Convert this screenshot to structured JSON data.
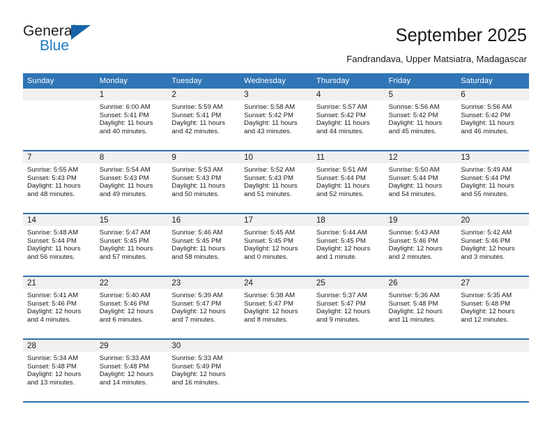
{
  "brand": {
    "name_top": "General",
    "name_bottom": "Blue",
    "accent_color": "#1463a8",
    "blue_text_color": "#1f7ac0"
  },
  "header": {
    "title": "September 2025",
    "subtitle": "Fandrandava, Upper Matsiatra, Madagascar"
  },
  "calendar": {
    "header_bg": "#3075b5",
    "row_border_color": "#2f6fad",
    "daynum_bg": "#f0f0f0",
    "weekday_headers": [
      "Sunday",
      "Monday",
      "Tuesday",
      "Wednesday",
      "Thursday",
      "Friday",
      "Saturday"
    ],
    "weeks": [
      [
        {
          "day": "",
          "lines": []
        },
        {
          "day": "1",
          "lines": [
            "Sunrise: 6:00 AM",
            "Sunset: 5:41 PM",
            "Daylight: 11 hours",
            "and 40 minutes."
          ]
        },
        {
          "day": "2",
          "lines": [
            "Sunrise: 5:59 AM",
            "Sunset: 5:41 PM",
            "Daylight: 11 hours",
            "and 42 minutes."
          ]
        },
        {
          "day": "3",
          "lines": [
            "Sunrise: 5:58 AM",
            "Sunset: 5:42 PM",
            "Daylight: 11 hours",
            "and 43 minutes."
          ]
        },
        {
          "day": "4",
          "lines": [
            "Sunrise: 5:57 AM",
            "Sunset: 5:42 PM",
            "Daylight: 11 hours",
            "and 44 minutes."
          ]
        },
        {
          "day": "5",
          "lines": [
            "Sunrise: 5:56 AM",
            "Sunset: 5:42 PM",
            "Daylight: 11 hours",
            "and 45 minutes."
          ]
        },
        {
          "day": "6",
          "lines": [
            "Sunrise: 5:56 AM",
            "Sunset: 5:42 PM",
            "Daylight: 11 hours",
            "and 46 minutes."
          ]
        }
      ],
      [
        {
          "day": "7",
          "lines": [
            "Sunrise: 5:55 AM",
            "Sunset: 5:43 PM",
            "Daylight: 11 hours",
            "and 48 minutes."
          ]
        },
        {
          "day": "8",
          "lines": [
            "Sunrise: 5:54 AM",
            "Sunset: 5:43 PM",
            "Daylight: 11 hours",
            "and 49 minutes."
          ]
        },
        {
          "day": "9",
          "lines": [
            "Sunrise: 5:53 AM",
            "Sunset: 5:43 PM",
            "Daylight: 11 hours",
            "and 50 minutes."
          ]
        },
        {
          "day": "10",
          "lines": [
            "Sunrise: 5:52 AM",
            "Sunset: 5:43 PM",
            "Daylight: 11 hours",
            "and 51 minutes."
          ]
        },
        {
          "day": "11",
          "lines": [
            "Sunrise: 5:51 AM",
            "Sunset: 5:44 PM",
            "Daylight: 11 hours",
            "and 52 minutes."
          ]
        },
        {
          "day": "12",
          "lines": [
            "Sunrise: 5:50 AM",
            "Sunset: 5:44 PM",
            "Daylight: 11 hours",
            "and 54 minutes."
          ]
        },
        {
          "day": "13",
          "lines": [
            "Sunrise: 5:49 AM",
            "Sunset: 5:44 PM",
            "Daylight: 11 hours",
            "and 55 minutes."
          ]
        }
      ],
      [
        {
          "day": "14",
          "lines": [
            "Sunrise: 5:48 AM",
            "Sunset: 5:44 PM",
            "Daylight: 11 hours",
            "and 56 minutes."
          ]
        },
        {
          "day": "15",
          "lines": [
            "Sunrise: 5:47 AM",
            "Sunset: 5:45 PM",
            "Daylight: 11 hours",
            "and 57 minutes."
          ]
        },
        {
          "day": "16",
          "lines": [
            "Sunrise: 5:46 AM",
            "Sunset: 5:45 PM",
            "Daylight: 11 hours",
            "and 58 minutes."
          ]
        },
        {
          "day": "17",
          "lines": [
            "Sunrise: 5:45 AM",
            "Sunset: 5:45 PM",
            "Daylight: 12 hours",
            "and 0 minutes."
          ]
        },
        {
          "day": "18",
          "lines": [
            "Sunrise: 5:44 AM",
            "Sunset: 5:45 PM",
            "Daylight: 12 hours",
            "and 1 minute."
          ]
        },
        {
          "day": "19",
          "lines": [
            "Sunrise: 5:43 AM",
            "Sunset: 5:46 PM",
            "Daylight: 12 hours",
            "and 2 minutes."
          ]
        },
        {
          "day": "20",
          "lines": [
            "Sunrise: 5:42 AM",
            "Sunset: 5:46 PM",
            "Daylight: 12 hours",
            "and 3 minutes."
          ]
        }
      ],
      [
        {
          "day": "21",
          "lines": [
            "Sunrise: 5:41 AM",
            "Sunset: 5:46 PM",
            "Daylight: 12 hours",
            "and 4 minutes."
          ]
        },
        {
          "day": "22",
          "lines": [
            "Sunrise: 5:40 AM",
            "Sunset: 5:46 PM",
            "Daylight: 12 hours",
            "and 6 minutes."
          ]
        },
        {
          "day": "23",
          "lines": [
            "Sunrise: 5:39 AM",
            "Sunset: 5:47 PM",
            "Daylight: 12 hours",
            "and 7 minutes."
          ]
        },
        {
          "day": "24",
          "lines": [
            "Sunrise: 5:38 AM",
            "Sunset: 5:47 PM",
            "Daylight: 12 hours",
            "and 8 minutes."
          ]
        },
        {
          "day": "25",
          "lines": [
            "Sunrise: 5:37 AM",
            "Sunset: 5:47 PM",
            "Daylight: 12 hours",
            "and 9 minutes."
          ]
        },
        {
          "day": "26",
          "lines": [
            "Sunrise: 5:36 AM",
            "Sunset: 5:48 PM",
            "Daylight: 12 hours",
            "and 11 minutes."
          ]
        },
        {
          "day": "27",
          "lines": [
            "Sunrise: 5:35 AM",
            "Sunset: 5:48 PM",
            "Daylight: 12 hours",
            "and 12 minutes."
          ]
        }
      ],
      [
        {
          "day": "28",
          "lines": [
            "Sunrise: 5:34 AM",
            "Sunset: 5:48 PM",
            "Daylight: 12 hours",
            "and 13 minutes."
          ]
        },
        {
          "day": "29",
          "lines": [
            "Sunrise: 5:33 AM",
            "Sunset: 5:48 PM",
            "Daylight: 12 hours",
            "and 14 minutes."
          ]
        },
        {
          "day": "30",
          "lines": [
            "Sunrise: 5:33 AM",
            "Sunset: 5:49 PM",
            "Daylight: 12 hours",
            "and 16 minutes."
          ]
        },
        {
          "day": "",
          "lines": []
        },
        {
          "day": "",
          "lines": []
        },
        {
          "day": "",
          "lines": []
        },
        {
          "day": "",
          "lines": []
        }
      ]
    ]
  }
}
